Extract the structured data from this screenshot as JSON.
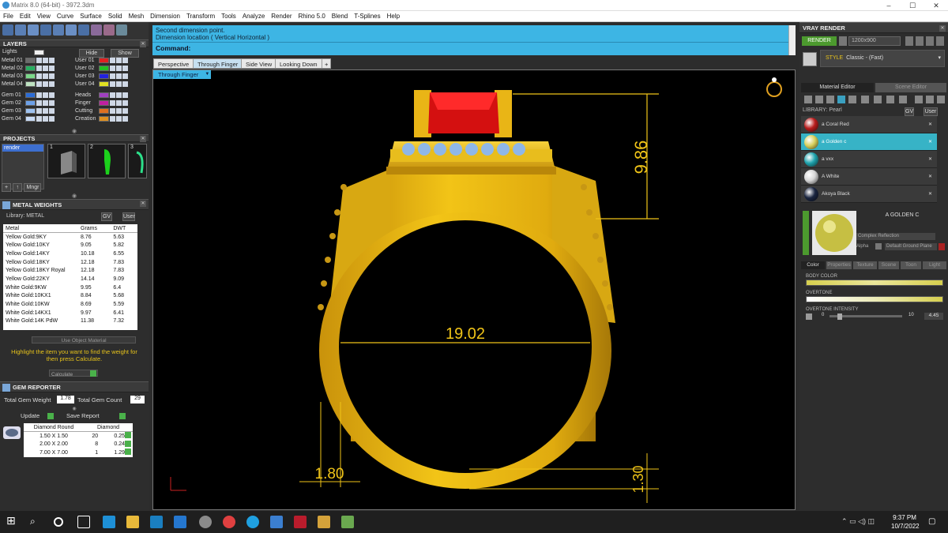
{
  "window": {
    "title": "Matrix 8.0 (64-bit) - 3972.3dm",
    "controls": [
      "–",
      "☐",
      "✕"
    ]
  },
  "menu": [
    "File",
    "Edit",
    "View",
    "Curve",
    "Surface",
    "Solid",
    "Mesh",
    "Dimension",
    "Transform",
    "Tools",
    "Analyze",
    "Render",
    "Rhino 5.0",
    "Blend",
    "T-Splines",
    "Help"
  ],
  "layers": {
    "header": "LAYERS",
    "lights_label": "Lights",
    "hide_label": "Hide",
    "show_label": "Show",
    "left": [
      {
        "name": "Metal 01",
        "color": "#6c6c6c"
      },
      {
        "name": "Metal 02",
        "color": "#27ae60"
      },
      {
        "name": "Metal 03",
        "color": "#7bd88a"
      },
      {
        "name": "Metal 04",
        "color": "#bfe3c2"
      },
      {
        "name": "Gem 01",
        "color": "#2b6cd6"
      },
      {
        "name": "Gem 02",
        "color": "#6ca0e8"
      },
      {
        "name": "Gem 03",
        "color": "#9ec2f0"
      },
      {
        "name": "Gem 04",
        "color": "#c8dbf6"
      }
    ],
    "right": [
      {
        "name": "User 01",
        "color": "#e02020"
      },
      {
        "name": "User 02",
        "color": "#22c022"
      },
      {
        "name": "User 03",
        "color": "#2222e0"
      },
      {
        "name": "User 04",
        "color": "#e0e022"
      },
      {
        "name": "Heads",
        "color": "#a040c0"
      },
      {
        "name": "Finger",
        "color": "#c020a0"
      },
      {
        "name": "Cutting",
        "color": "#e07020"
      },
      {
        "name": "Creation",
        "color": "#e09020"
      }
    ]
  },
  "projects": {
    "header": "PROJECTS",
    "items": [
      "render"
    ],
    "thumbs": [
      "1",
      "2",
      "3"
    ],
    "mngr_label": "Mngr"
  },
  "metal_weights": {
    "header": "METAL WEIGHTS",
    "library_label": "Library: METAL",
    "gv_label": "GV",
    "user_label": "User",
    "columns": [
      "Metal",
      "Grams",
      "DWT"
    ],
    "rows": [
      [
        "Yellow Gold:9KY",
        "8.76",
        "5.63"
      ],
      [
        "Yellow Gold:10KY",
        "9.05",
        "5.82"
      ],
      [
        "Yellow Gold:14KY",
        "10.18",
        "6.55"
      ],
      [
        "Yellow Gold:18KY",
        "12.18",
        "7.83"
      ],
      [
        "Yellow Gold:18KY Royal",
        "12.18",
        "7.83"
      ],
      [
        "Yellow Gold:22KY",
        "14.14",
        "9.09"
      ],
      [
        "White Gold:9KW",
        "9.95",
        "6.4"
      ],
      [
        "White Gold:10KX1",
        "8.84",
        "5.68"
      ],
      [
        "White Gold:10KW",
        "8.69",
        "5.59"
      ],
      [
        "White Gold:14KX1",
        "9.97",
        "6.41"
      ],
      [
        "White Gold:14K PdW",
        "11.38",
        "7.32"
      ]
    ],
    "use_object_material": "Use Object Material",
    "hint": "Highlight the item you want to find the weight for then press Calculate.",
    "calculate_label": "Calculate"
  },
  "gem_reporter": {
    "header": "GEM REPORTER",
    "total_weight_label": "Total Gem Weight",
    "total_weight": "1.78",
    "total_count_label": "Total Gem Count",
    "total_count": "29",
    "update_label": "Update",
    "save_label": "Save Report",
    "columns": [
      "Diamond Round",
      "Diamond"
    ],
    "rows": [
      [
        "1.50 X 1.50",
        "20",
        "0.25tw"
      ],
      [
        "2.00 X 2.00",
        "8",
        "0.24tw"
      ],
      [
        "7.00 X 7.00",
        "1",
        "1.29tw"
      ]
    ]
  },
  "command": {
    "line1": "Second dimension point.",
    "line2": "Dimension location ( Vertical  Horizontal )",
    "prompt": "Command:"
  },
  "viewport_tabs": [
    "Perspective",
    "Through Finger",
    "Side View",
    "Looking Down",
    "+"
  ],
  "active_view": "Through Finger",
  "dimensions": {
    "height": "9.86",
    "inner_diameter": "19.02",
    "shank_width": "1.80",
    "bottom_thickness": "1.30"
  },
  "vray": {
    "header": "VRAY RENDER",
    "render_label": "RENDER",
    "resolution": "1200x900",
    "style_label": "STYLE",
    "style_value": "Classic - (Fast)",
    "tabs": [
      "Material Editor",
      "Scene Editor"
    ],
    "library_label": "LIBRARY: Pearl",
    "materials": [
      {
        "name": "a Coral Red",
        "color": "#b81c1c"
      },
      {
        "name": "a Golden c",
        "color": "#d8cf5a"
      },
      {
        "name": "a vxx",
        "color": "#1fa3ad"
      },
      {
        "name": "A White",
        "color": "#d6d6d6"
      },
      {
        "name": "Akoya Black",
        "color": "#1a2540"
      }
    ],
    "selected_material": "A GOLDEN C",
    "complex_reflection": "Complex Reflection",
    "alpha_label": "Alpha",
    "ground_plane": "Default Ground Plane",
    "prop_tabs": [
      "Color",
      "Properties",
      "Texture",
      "Scene",
      "Toon",
      "Light"
    ],
    "body_color_label": "BODY COLOR",
    "overtone_label": "OVERTONE",
    "overtone_intensity_label": "OVERTONE INTENSITY",
    "intensity_min": "0",
    "intensity_max": "10",
    "intensity_value": "4.45"
  },
  "taskbar": {
    "time": "9:37 PM",
    "date": "10/7/2022"
  }
}
